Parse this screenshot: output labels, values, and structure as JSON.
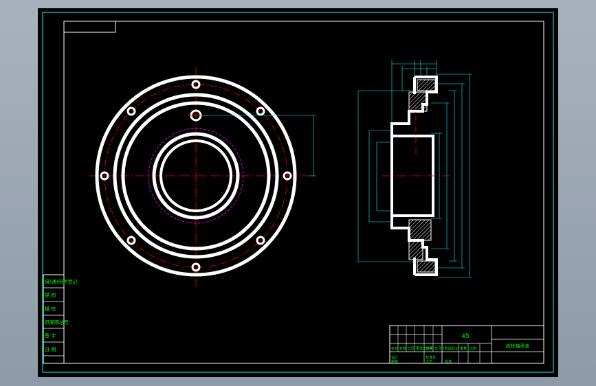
{
  "drawing": {
    "material": "45",
    "part_name": "齿轮轴承盖",
    "left_panel": [
      "借(通)用件登记",
      "描 图",
      "描 校",
      "旧底图总号",
      "签 字",
      "日 期"
    ],
    "title_block_labels": [
      "标记",
      "处数",
      "分区",
      "更改文件号",
      "签名",
      "年月日",
      "设计",
      "标准化",
      "阶段标记",
      "重量",
      "比例",
      "审核",
      "工艺",
      "批准"
    ]
  },
  "colors": {
    "frame": "#00ffff",
    "outline": "#ffffff",
    "centerline": "#ff0000",
    "hatch": "#ffffff",
    "text": "#00ff00",
    "hidden": "#ff00ff"
  }
}
